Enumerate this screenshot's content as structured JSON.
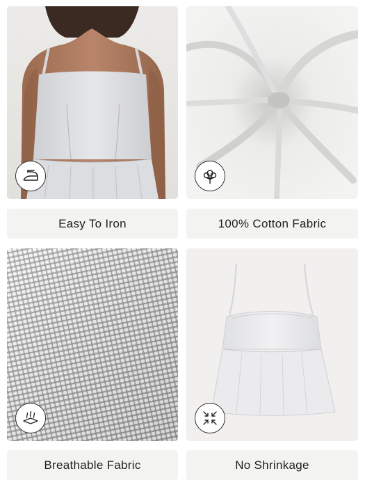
{
  "features": [
    {
      "label": "Easy To Iron",
      "icon": "iron-icon"
    },
    {
      "label": "100% Cotton Fabric",
      "icon": "cotton-flower-icon"
    },
    {
      "label": "Breathable Fabric",
      "icon": "breathable-fabric-icon"
    },
    {
      "label": "No Shrinkage",
      "icon": "no-shrink-arrows-icon"
    }
  ],
  "colors": {
    "label_background": "#f3f3f1",
    "label_text": "#1e1e1e",
    "garment": "#e9e9ea"
  }
}
